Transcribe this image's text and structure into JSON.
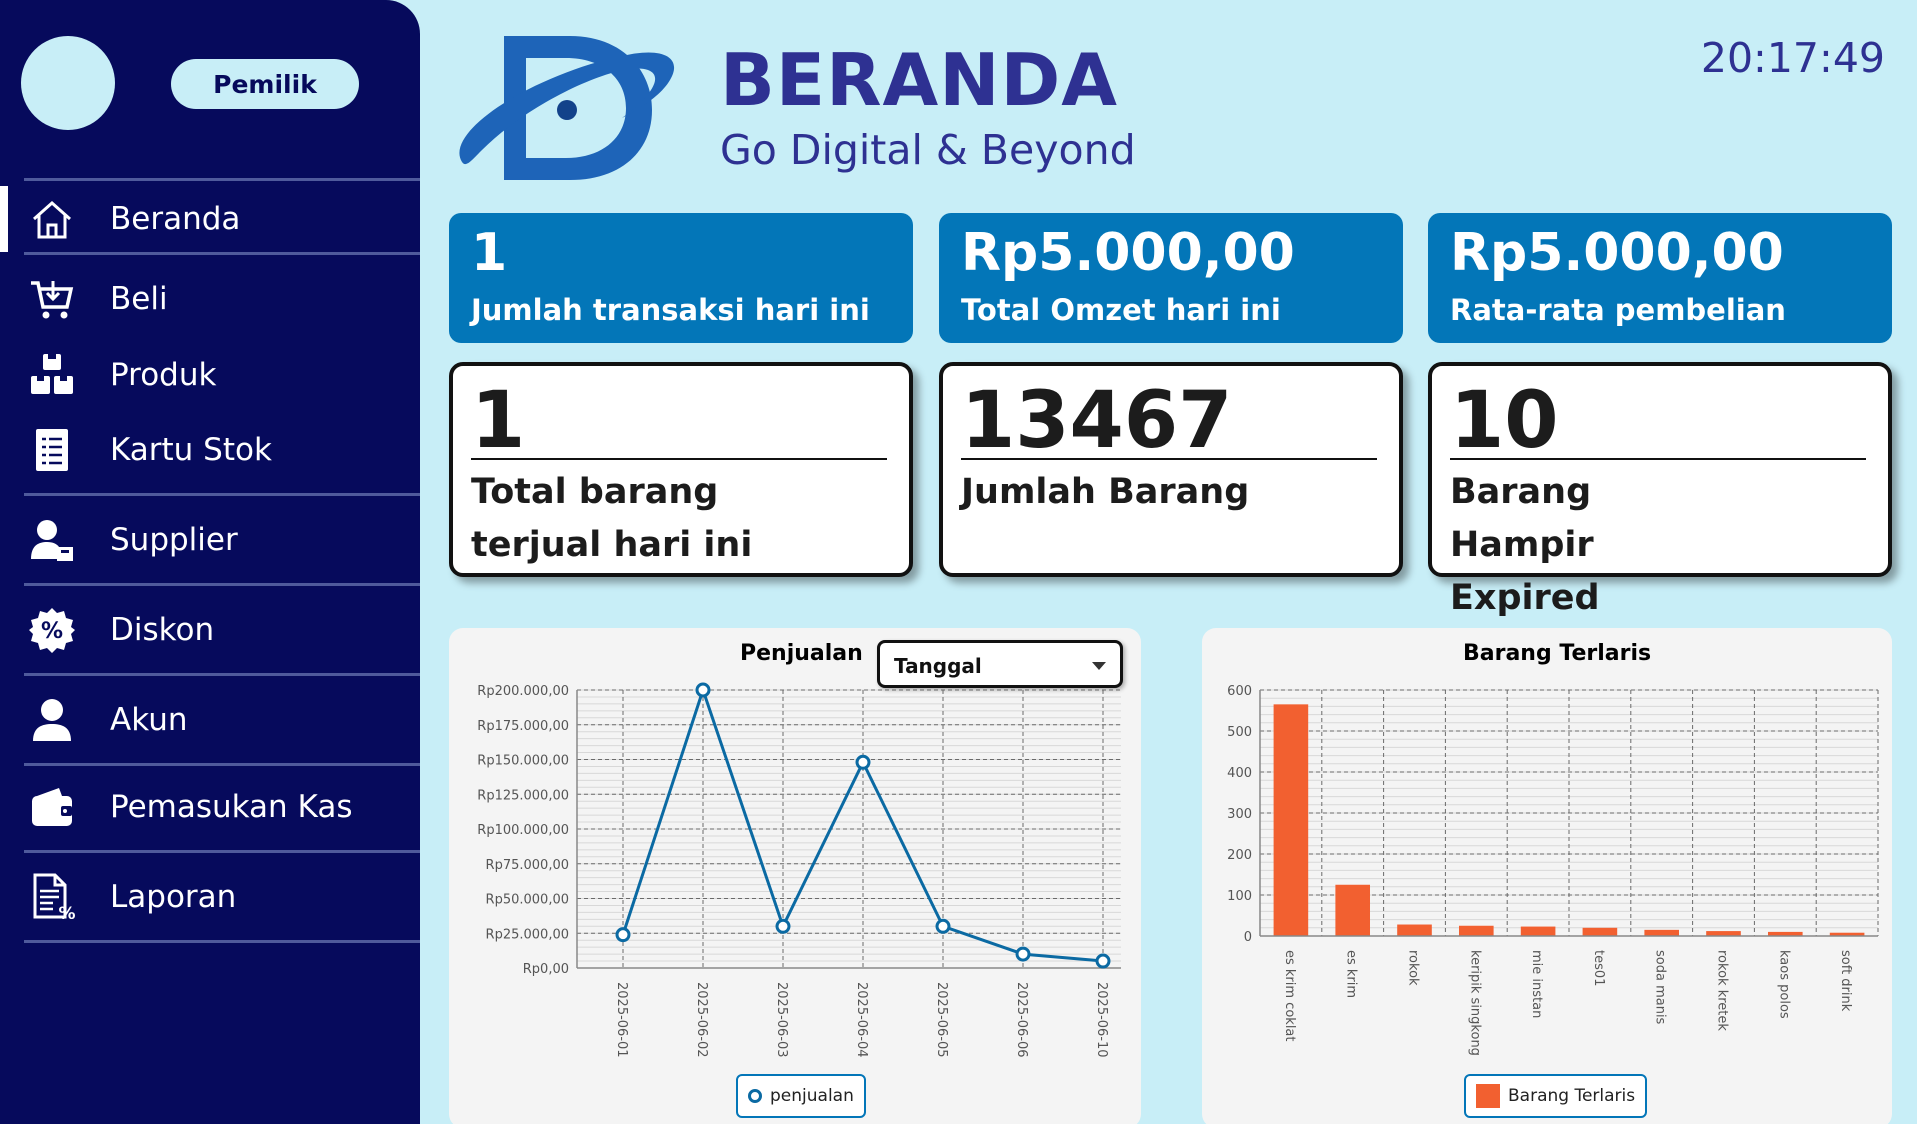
{
  "header": {
    "title": "BERANDA",
    "subtitle": "Go Digital & Beyond",
    "clock": "20:17:49",
    "logo_icon": "go-digital-logo-icon"
  },
  "sidebar": {
    "role": "Pemilik",
    "items": [
      {
        "label": "Beranda",
        "icon": "home-icon",
        "active": true
      },
      {
        "label": "Beli",
        "icon": "cart-icon"
      },
      {
        "label": "Produk",
        "icon": "boxes-icon"
      },
      {
        "label": "Kartu Stok",
        "icon": "stock-card-icon"
      },
      {
        "label": "Supplier",
        "icon": "supplier-icon"
      },
      {
        "label": "Diskon",
        "icon": "discount-icon"
      },
      {
        "label": "Akun",
        "icon": "user-icon"
      },
      {
        "label": "Pemasukan Kas",
        "icon": "wallet-icon"
      },
      {
        "label": "Laporan",
        "icon": "report-icon"
      }
    ]
  },
  "stats": {
    "blue": [
      {
        "value": "1",
        "label": "Jumlah transaksi hari ini"
      },
      {
        "value": "Rp5.000,00",
        "label": "Total Omzet hari ini"
      },
      {
        "value": "Rp5.000,00",
        "label": "Rata-rata pembelian"
      }
    ],
    "white": [
      {
        "value": "1",
        "label": "Total barang terjual hari ini"
      },
      {
        "value": "13467",
        "label": "Jumlah Barang"
      },
      {
        "value": "10",
        "label": "Barang Hampir Expired"
      }
    ]
  },
  "sales_panel": {
    "title": "Penjualan",
    "select_value": "Tanggal",
    "legend": "penjualan"
  },
  "best_panel": {
    "title": "Barang Terlaris",
    "legend": "Barang Terlaris"
  },
  "colors": {
    "sidebar": "#060a5c",
    "background": "#c8eef7",
    "card_blue": "#0376b8",
    "title": "#2e3192",
    "line": "#0b6aa3",
    "bar": "#f26030"
  },
  "chart_data": [
    {
      "type": "line",
      "title": "Penjualan",
      "x": [
        "2025-06-01",
        "2025-06-02",
        "2025-06-03",
        "2025-06-04",
        "2025-06-05",
        "2025-06-06",
        "2025-06-10"
      ],
      "series": [
        {
          "name": "penjualan",
          "values": [
            24000,
            200000,
            30000,
            148000,
            30000,
            10000,
            5000
          ]
        }
      ],
      "ylim": [
        0,
        200000
      ],
      "yticks": [
        0,
        25000,
        50000,
        75000,
        100000,
        125000,
        150000,
        175000,
        200000
      ],
      "ytick_labels": [
        "Rp0,00",
        "Rp25.000,00",
        "Rp50.000,00",
        "Rp75.000,00",
        "Rp100.000,00",
        "Rp125.000,00",
        "Rp150.000,00",
        "Rp175.000,00",
        "Rp200.000,00"
      ],
      "grid": true,
      "legend": "bottom"
    },
    {
      "type": "bar",
      "title": "Barang Terlaris",
      "categories": [
        "es krim coklat",
        "es krim",
        "rokok",
        "keripik singkong",
        "mie instan",
        "tes01",
        "soda manis",
        "rokok kretek",
        "kaos polos",
        "soft drink"
      ],
      "series": [
        {
          "name": "Barang Terlaris",
          "values": [
            565,
            125,
            28,
            25,
            23,
            20,
            15,
            12,
            10,
            8
          ]
        }
      ],
      "ylim": [
        0,
        600
      ],
      "yticks": [
        0,
        100,
        200,
        300,
        400,
        500,
        600
      ],
      "grid": true,
      "legend": "bottom"
    }
  ]
}
